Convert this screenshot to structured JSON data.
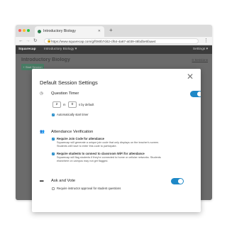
{
  "browser": {
    "tab_title": "Introductory Biology",
    "tab_close": "✕",
    "new_tab": "+",
    "back": "←",
    "forward": "→",
    "reload": "↻",
    "url": "https://www.squarecap.com/g/f080b7d42-cf64-4a67-a039-48bdbe5faae4",
    "menu": "⋮",
    "traffic_colors": [
      "#fd5f57",
      "#febc2e",
      "#29c840"
    ]
  },
  "app": {
    "logo": "Squarecap",
    "course": "Introductory Biology ▾",
    "settings": "Settings ▾"
  },
  "page": {
    "title": "Introductory Biology",
    "sessions_link": "0 Sessions",
    "start_button": "+ Start Session"
  },
  "modal": {
    "title": "Default Session Settings",
    "close": "✕",
    "question_timer": {
      "label": "Question Timer",
      "minutes": "2",
      "sep": "m",
      "seconds": "0",
      "suffix": "s by default",
      "auto_start": "Automatically start timer",
      "enabled": true
    },
    "attendance": {
      "label": "Attendance Verification",
      "join_code_title": "Require Join Code for attendance",
      "join_code_desc1": "Squarecap will generate a unique join code that only displays on the teacher's screen.",
      "join_code_desc2": "Students will have to enter this code to participate.",
      "wifi_title": "Require students to connect to classroom WiFi for attendance",
      "wifi_desc1": "Squarecap will flag students if they're connected to home or cellular networks. Students",
      "wifi_desc2": "elsewhere on campus may not get flagged."
    },
    "ask_vote": {
      "label": "Ask and Vote",
      "approval": "Require instructor approval for student questions",
      "enabled": true
    }
  }
}
